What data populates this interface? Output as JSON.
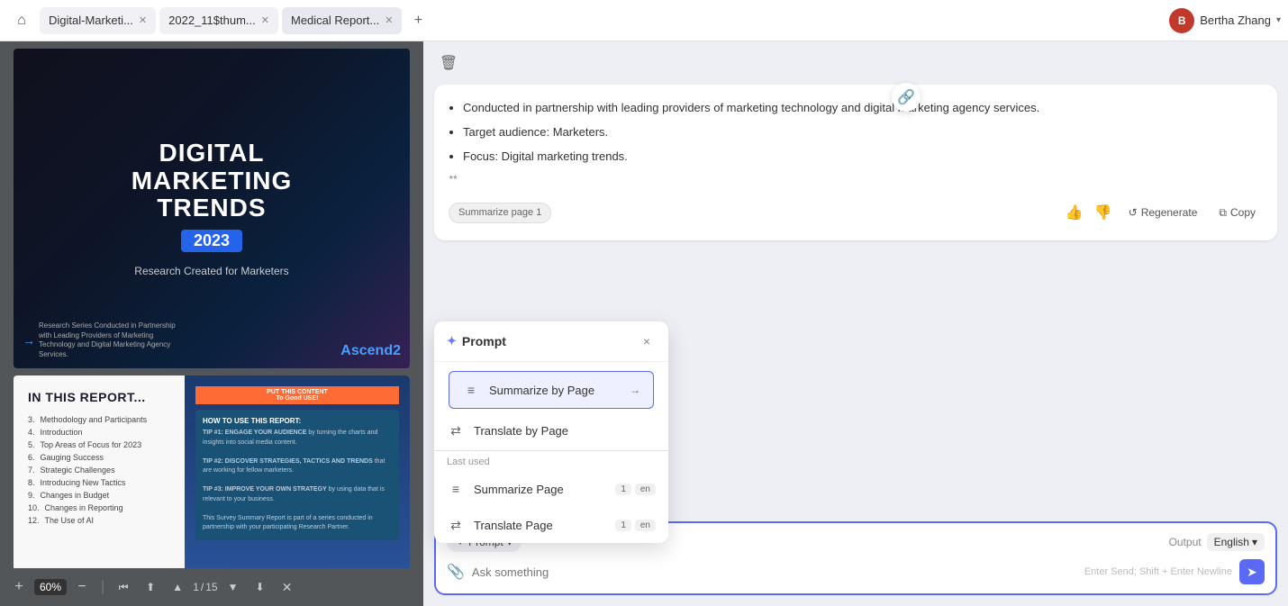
{
  "topbar": {
    "home_icon": "⌂",
    "tabs": [
      {
        "label": "Digital-Marketi...",
        "active": false,
        "closable": true
      },
      {
        "label": "2022_11$thum...",
        "active": false,
        "closable": true
      },
      {
        "label": "Medical Report...",
        "active": true,
        "closable": true
      }
    ],
    "add_tab_icon": "+",
    "user_initial": "B",
    "user_name": "Bertha Zhang",
    "chevron": "▾"
  },
  "pdf": {
    "delete_icon": "🗑",
    "zoom_minus": "−",
    "zoom_value": "60%",
    "zoom_plus": "+",
    "nav_first": "⏮",
    "nav_prev_prev": "↑",
    "nav_prev": "↑",
    "page_current": "1",
    "page_sep": "/",
    "page_total": "15",
    "nav_next": "↓",
    "nav_next_next": "↓",
    "nav_last": "×",
    "page1": {
      "title_line1": "DIGITAL",
      "title_line2": "MARKETING",
      "title_line3": "TRENDS",
      "year": "2023",
      "subtitle": "Research Created for Marketers",
      "logo_left": "Research Series Conducted in Partnership with Leading Providers of Marketing Technology and Digital Marketing Agency Services.",
      "arrow": "→",
      "logo_right": "Ascend2"
    },
    "page2": {
      "title": "IN THIS REPORT...",
      "toc": [
        {
          "num": "3.",
          "text": "Methodology and Participants"
        },
        {
          "num": "4.",
          "text": "Introduction"
        },
        {
          "num": "5.",
          "text": "Top Areas of Focus for 2023"
        },
        {
          "num": "6.",
          "text": "Gauging Success"
        },
        {
          "num": "7.",
          "text": "Strategic Challenges"
        },
        {
          "num": "8.",
          "text": "Introducing New Tactics"
        },
        {
          "num": "9.",
          "text": "Changes in Budget"
        },
        {
          "num": "10.",
          "text": "Changes in Reporting"
        },
        {
          "num": "12.",
          "text": "The Use of AI"
        }
      ],
      "banner": "HOW TO USE THIS REPORT:",
      "tips": "TIP #1: ENGAGE YOUR AUDIENCE by turning the charts and insights into social media content.\n\nTIP #2: DISCOVER STRATEGIES, TACTICS AND TRENDS that are working for fellow marketers.\n\nTIP #3: IMPROVE YOUR OWN STRATEGY by using data that is relevant to your business.\n\nThis Survey Summary Report is part of a series conducted in partnership with your participating Research Partner."
    }
  },
  "chat": {
    "bullet1": "Conducted in partnership with leading providers of marketing technology and digital marketing agency services.",
    "bullet2": "Target audience: Marketers.",
    "bullet3": "Focus: Digital marketing trends.",
    "double_stars": "**",
    "tag": "Summarize page 1",
    "thumbs_up": "👍",
    "thumbs_down": "👎",
    "regenerate_icon": "↺",
    "regenerate_label": "Regenerate",
    "copy_icon": "⧉",
    "copy_label": "Copy"
  },
  "prompt_dropdown": {
    "title": "Prompt",
    "close_icon": "×",
    "items": [
      {
        "icon": "≡",
        "label": "Summarize by Page",
        "selected": true,
        "arrow": "→"
      },
      {
        "icon": "⇄",
        "label": "Translate by Page",
        "selected": false
      }
    ],
    "section_label": "Last used",
    "last_used": [
      {
        "icon": "≡",
        "label": "Summarize Page",
        "badge_num": "1",
        "badge_lang": "en"
      },
      {
        "icon": "⇄",
        "label": "Translate Page",
        "badge_num": "1",
        "badge_lang": "en"
      }
    ]
  },
  "input_area": {
    "prompt_label": "Prompt",
    "prompt_arrow": "▾",
    "output_label": "Output",
    "lang_label": "English",
    "lang_arrow": "▾",
    "attachment_icon": "📎",
    "placeholder": "Ask something",
    "hint": "Enter Send; Shift + Enter Newline",
    "send_icon": "➤"
  }
}
